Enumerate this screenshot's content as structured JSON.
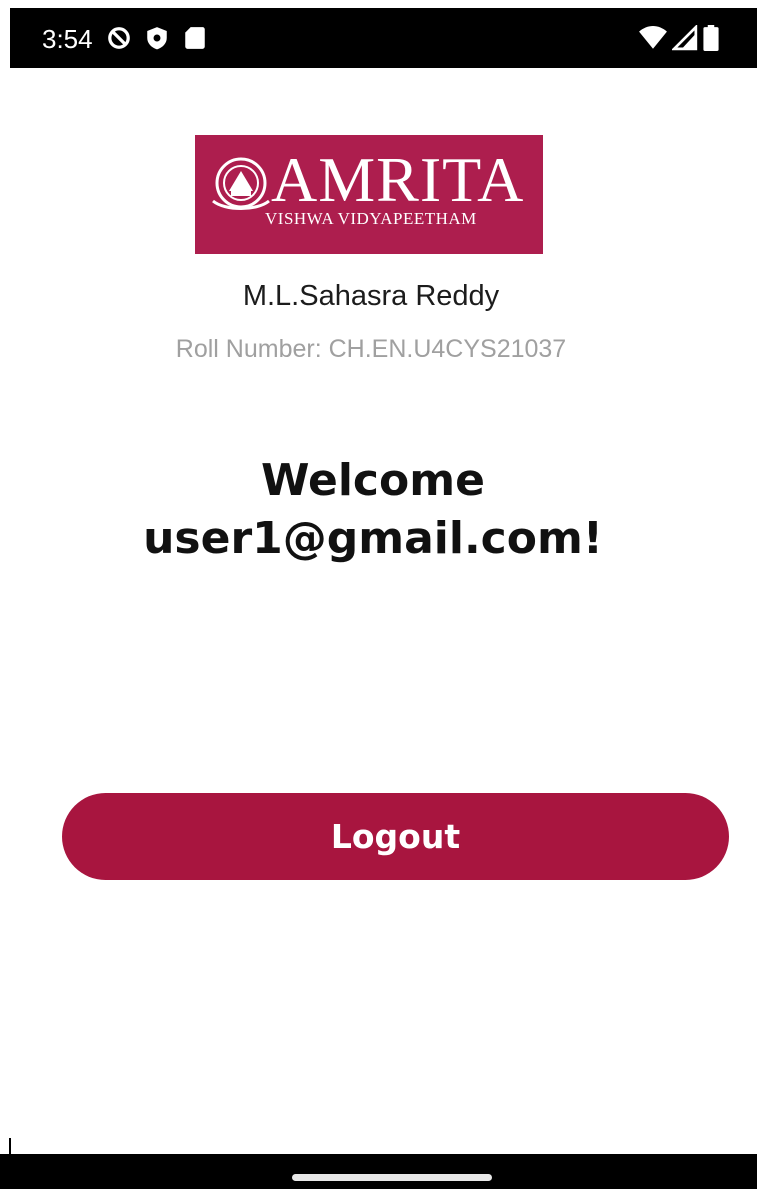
{
  "status_bar": {
    "time": "3:54",
    "left_icons": [
      "do-not-disturb-icon",
      "shield-icon",
      "sd-card-icon"
    ],
    "right_icons": [
      "wifi-icon",
      "cell-signal-icon",
      "battery-icon"
    ]
  },
  "logo": {
    "main_text": "AMRITA",
    "sub_text": "VISHWA VIDYAPEETHAM",
    "background_color": "#ad1e4e"
  },
  "profile": {
    "name": "M.L.Sahasra Reddy",
    "roll_number": "Roll Number: CH.EN.U4CYS21037"
  },
  "welcome": {
    "line1": "Welcome",
    "line2": "user1@gmail.com!"
  },
  "logout_button": {
    "label": "Logout",
    "color": "#a8153f"
  }
}
